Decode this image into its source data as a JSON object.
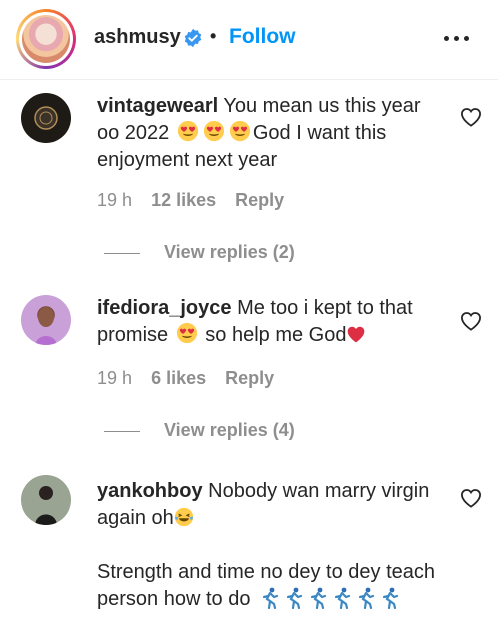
{
  "header": {
    "username": "ashmusy",
    "separator": "•",
    "follow_label": "Follow"
  },
  "comments": [
    {
      "username": "vintagewearl",
      "text_part1": "You mean us this year oo 2022",
      "text_part2": "God I want this enjoyment next year",
      "time": "19 h",
      "likes": "12 likes",
      "reply": "Reply",
      "view_replies": "View replies (2)"
    },
    {
      "username": "ifediora_joyce",
      "text_part1": "Me too i kept to that promise",
      "text_part2": "so help me God",
      "time": "19 h",
      "likes": "6 likes",
      "reply": "Reply",
      "view_replies": "View replies (4)"
    },
    {
      "username": "yankohboy",
      "text_part1": "Nobody wan marry virgin again oh",
      "text_part2": "Strength and time no dey to dey teach person how to do"
    }
  ],
  "icons": {
    "verified": "verified-badge-icon",
    "more": "more-options-icon",
    "like": "heart-outline-icon",
    "heart_eyes": "heart-eyes-emoji",
    "laughing": "laughing-emoji",
    "red_heart": "red-heart-emoji",
    "runner": "running-person-emoji"
  },
  "colors": {
    "follow": "#0095f6",
    "muted": "#8e8e8e",
    "text": "#262626"
  }
}
